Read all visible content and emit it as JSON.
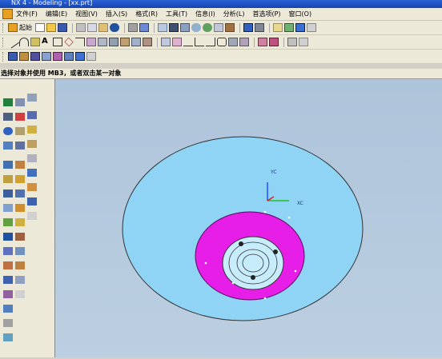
{
  "window": {
    "title": "NX 4 - Modeling - [xx.prt]"
  },
  "menu": [
    "文件(F)",
    "编辑(E)",
    "视图(V)",
    "插入(S)",
    "格式(R)",
    "工具(T)",
    "信息(I)",
    "分析(L)",
    "首选项(P)",
    "窗口(O)"
  ],
  "toolbar": {
    "start_label": "起始"
  },
  "status": {
    "prompt": "选择对象并使用 MB3，或者双击某一对象"
  },
  "viewport": {
    "axis_labels": {
      "y": "YC",
      "x": "XC"
    },
    "colors": {
      "background": "#b4c8dc",
      "disk": "#8fd3f5",
      "flange": "#e71ee8",
      "hub": "#c7ecfc",
      "axis_y": "#2050ff",
      "axis_x": "#20c020",
      "axis_z": "#e02020"
    }
  }
}
